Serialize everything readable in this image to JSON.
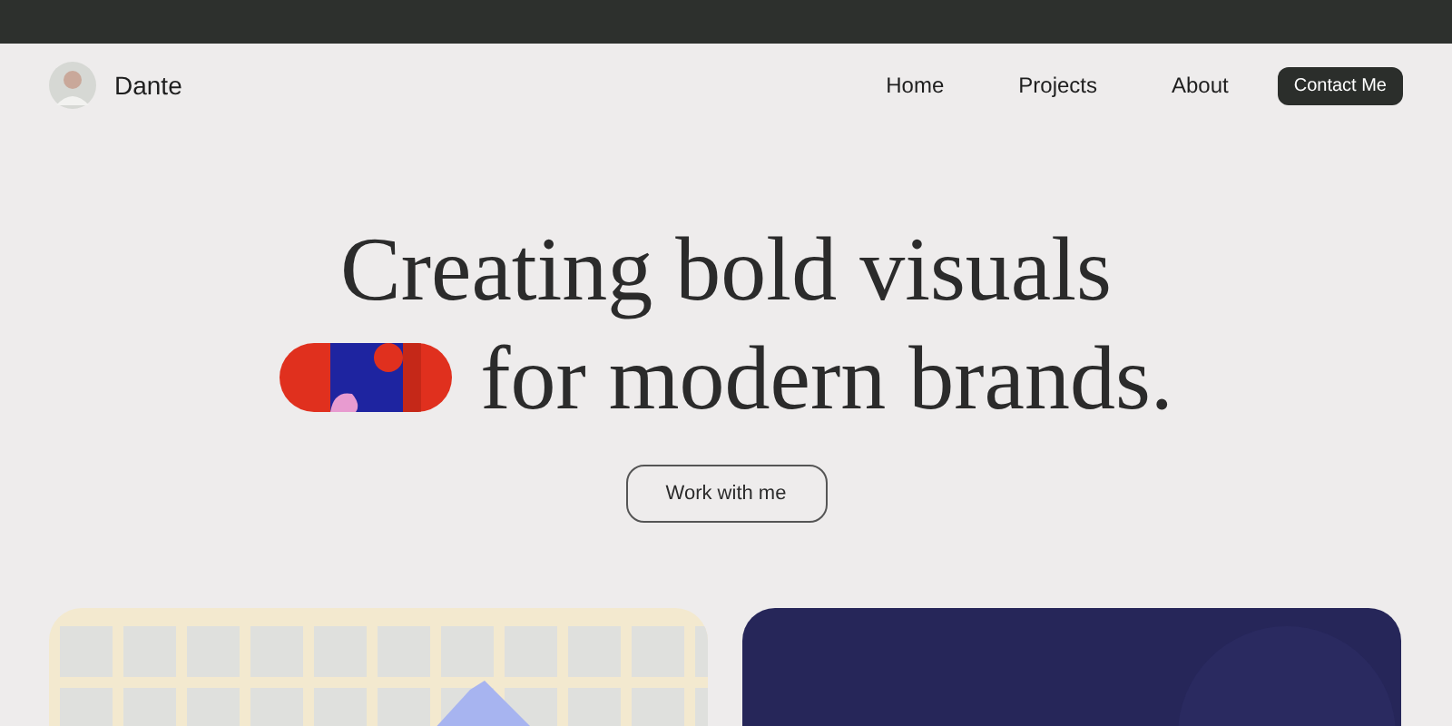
{
  "header": {
    "name": "Dante",
    "nav": [
      {
        "label": "Home"
      },
      {
        "label": "Projects"
      },
      {
        "label": "About"
      }
    ],
    "cta": "Contact Me"
  },
  "hero": {
    "line_1": "Creating bold visuals",
    "line_2": "for modern brands.",
    "button": "Work with me"
  }
}
